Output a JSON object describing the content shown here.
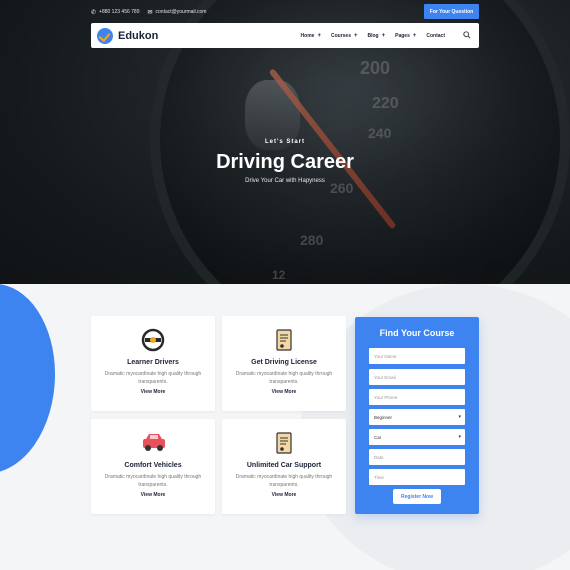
{
  "topbar": {
    "phone": "+880 123 456 789",
    "email": "contact@yourmail.com",
    "question_button": "For Your Question"
  },
  "brand": {
    "name": "Edukon",
    "accent": "#3e84f0"
  },
  "nav": {
    "items": [
      {
        "label": "Home",
        "has_submenu": true
      },
      {
        "label": "Courses",
        "has_submenu": true
      },
      {
        "label": "Blog",
        "has_submenu": true
      },
      {
        "label": "Pages",
        "has_submenu": true
      },
      {
        "label": "Contact",
        "has_submenu": false
      }
    ],
    "search_icon": "search-icon"
  },
  "hero": {
    "kicker": "Let's Start",
    "title": "Driving Career",
    "subtitle": "Drive Your Car with Hapyness",
    "gauge_numbers": [
      "200",
      "220",
      "240",
      "260",
      "280",
      "12"
    ]
  },
  "cards": [
    {
      "title": "Learner Drivers",
      "desc": "Dramatic myocardinate high quality through transparents.",
      "link": "View More",
      "icon": "steering-wheel-icon"
    },
    {
      "title": "Get Driving License",
      "desc": "Dramatic myocardinate high quality through transparents.",
      "link": "View More",
      "icon": "license-document-icon"
    },
    {
      "title": "Comfort Vehicles",
      "desc": "Dramatic myocardinate high quality through transparents.",
      "link": "View More",
      "icon": "car-icon"
    },
    {
      "title": "Unlimited Car Support",
      "desc": "Dramatic myocardinate high quality through transparents.",
      "link": "View More",
      "icon": "certificate-document-icon"
    }
  ],
  "form": {
    "title": "Find Your Course",
    "name_placeholder": "Your Name",
    "email_placeholder": "Your Email",
    "phone_placeholder": "Your Phone",
    "level_value": "Beginner",
    "vehicle_value": "Car",
    "date_placeholder": "Date",
    "time_placeholder": "Time",
    "submit": "Register Now"
  }
}
